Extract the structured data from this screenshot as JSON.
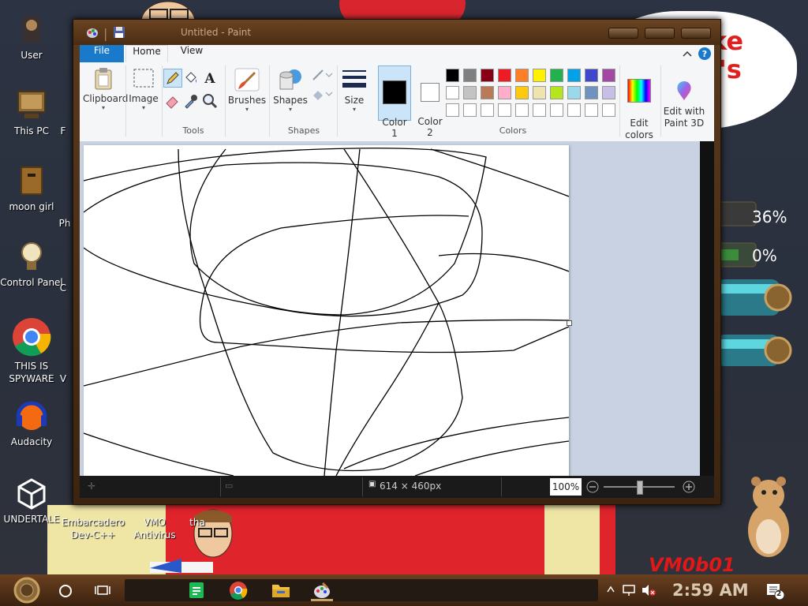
{
  "desktop": {
    "icons_left": [
      {
        "label": "User",
        "icon": "user-folder-icon"
      },
      {
        "label": "This PC",
        "icon": "computer-icon"
      },
      {
        "label": "moon girl",
        "icon": "folder-icon"
      },
      {
        "label": "Control Panel",
        "icon": "lightbulb-icon"
      },
      {
        "label": "THIS IS SPYWARE",
        "icon": "chrome-icon"
      },
      {
        "label": "Audacity",
        "icon": "audacity-icon"
      },
      {
        "label": "UNDERTALE",
        "icon": "unity-icon"
      }
    ],
    "icons_bottom": [
      {
        "label": "Embarcadero Dev-C++",
        "icon": "devcpp-icon"
      },
      {
        "label": "VMO Antivirus",
        "icon": "antivirus-icon"
      },
      {
        "label": "tha",
        "icon": "character-icon"
      }
    ],
    "partial_labels": [
      "F",
      "Ph",
      "C",
      "V"
    ],
    "speech_bubble_text": [
      "ke",
      "l's"
    ],
    "gauges": [
      "36%",
      "0%"
    ],
    "watermark": "VM0b01"
  },
  "paint": {
    "title": "Untitled - Paint",
    "tabs": {
      "file": "File",
      "home": "Home",
      "view": "View"
    },
    "ribbon": {
      "clipboard": "Clipboard",
      "image": "Image",
      "tools_group": "Tools",
      "brushes": "Brushes",
      "shapes": "Shapes",
      "shapes_group": "Shapes",
      "size": "Size",
      "color1": "Color\n1",
      "color2": "Color\n2",
      "colors_group": "Colors",
      "edit_colors": "Edit\ncolors",
      "edit_paint3d": "Edit with\nPaint 3D"
    },
    "palette_row1": [
      "#000000",
      "#7f7f7f",
      "#880015",
      "#ed1c24",
      "#ff7f27",
      "#fff200",
      "#22b14c",
      "#00a2e8",
      "#3f48cc",
      "#a349a4"
    ],
    "palette_row2": [
      "#ffffff",
      "#c3c3c3",
      "#b97a57",
      "#ffaec9",
      "#ffc90e",
      "#efe4b0",
      "#b5e61d",
      "#99d9ea",
      "#7092be",
      "#c8bfe7"
    ],
    "palette_row3": [
      "#ffffff",
      "#ffffff",
      "#ffffff",
      "#ffffff",
      "#ffffff",
      "#ffffff",
      "#ffffff",
      "#ffffff",
      "#ffffff",
      "#ffffff"
    ],
    "color1": "#000000",
    "color2": "#ffffff",
    "status": {
      "dimensions": "614 × 460px",
      "zoom": "100%"
    }
  },
  "taskbar": {
    "clock": "2:59 AM",
    "notifications": "2",
    "apps": [
      "spotify-icon",
      "chrome-icon",
      "file-explorer-icon",
      "paint-icon"
    ]
  }
}
